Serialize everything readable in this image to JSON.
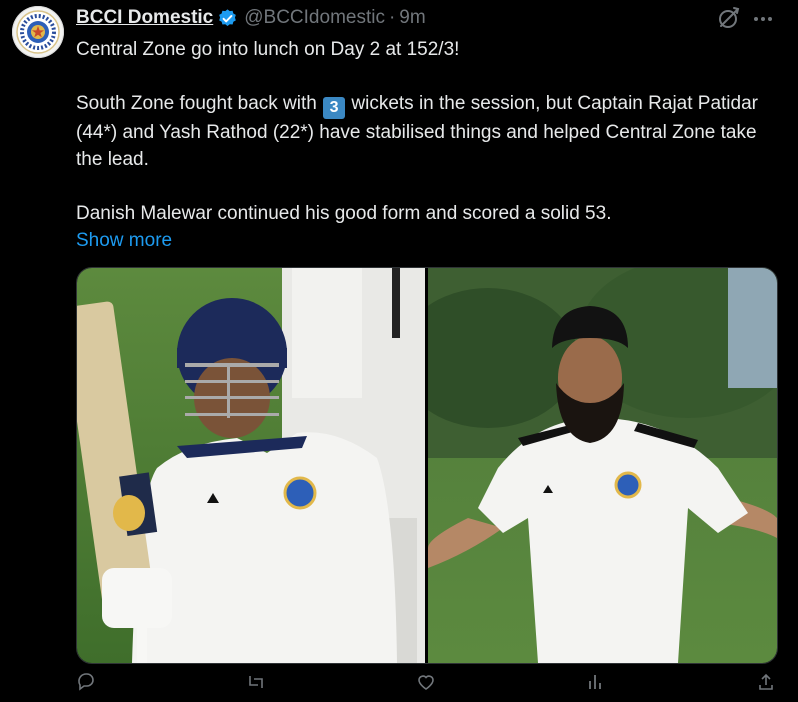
{
  "author": {
    "display_name": "BCCI Domestic",
    "handle": "@BCCIdomestic",
    "separator": "·",
    "time": "9m"
  },
  "tweet": {
    "line1": "Central Zone go into lunch on Day 2 at 152/3!",
    "line2_before": "South Zone fought back with",
    "line2_keycap": "3",
    "line2_after": "wickets in the session, but Captain Rajat Patidar (44*) and Yash Rathod (22*) have stabilised things and helped Central Zone take the lead.",
    "line3": "Danish Malewar continued his good form and scored a solid 53.",
    "show_more": "Show more"
  },
  "media": [
    {
      "alt": "photo-batter-raising-bat",
      "jersey_color": "#f4f4f2",
      "helmet_color": "#1c2a5a"
    },
    {
      "alt": "photo-player-in-patka",
      "jersey_color": "#f4f4f2",
      "patka_color": "#111111"
    }
  ],
  "icons": {
    "verified": "verified-badge-icon",
    "grok": "grok-icon",
    "more": "more-options-icon",
    "reply": "reply-icon",
    "retweet": "retweet-icon",
    "like": "like-icon",
    "views": "views-icon",
    "share": "share-icon"
  },
  "colors": {
    "background": "#000000",
    "text": "#e7e9ea",
    "muted": "#71767b",
    "accent": "#1d9bf0"
  }
}
